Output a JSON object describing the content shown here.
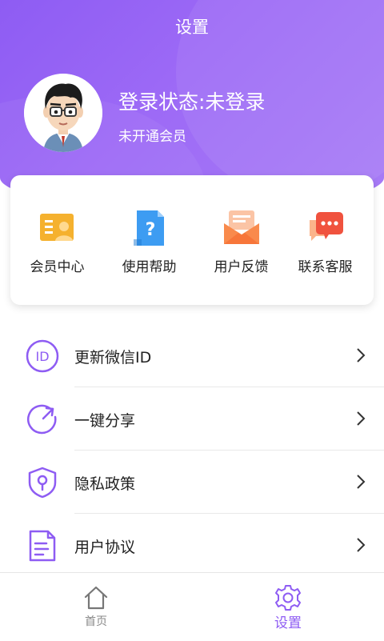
{
  "header": {
    "title": "设置",
    "login_status": "登录状态:未登录",
    "member_status": "未开通会员"
  },
  "quick_actions": [
    {
      "label": "会员中心",
      "icon": "member-card-icon"
    },
    {
      "label": "使用帮助",
      "icon": "help-document-icon"
    },
    {
      "label": "用户反馈",
      "icon": "feedback-mail-icon"
    },
    {
      "label": "联系客服",
      "icon": "chat-service-icon"
    }
  ],
  "menu": [
    {
      "label": "更新微信ID",
      "icon": "id-icon"
    },
    {
      "label": "一键分享",
      "icon": "share-icon"
    },
    {
      "label": "隐私政策",
      "icon": "privacy-shield-icon"
    },
    {
      "label": "用户协议",
      "icon": "agreement-document-icon"
    }
  ],
  "tabbar": {
    "items": [
      {
        "label": "首页",
        "icon": "home-icon",
        "active": false
      },
      {
        "label": "设置",
        "icon": "gear-icon",
        "active": true
      }
    ]
  },
  "colors": {
    "accent": "#8e5cf3",
    "header_gradient_start": "#8e5cf3",
    "header_gradient_end": "#a77cf6"
  }
}
